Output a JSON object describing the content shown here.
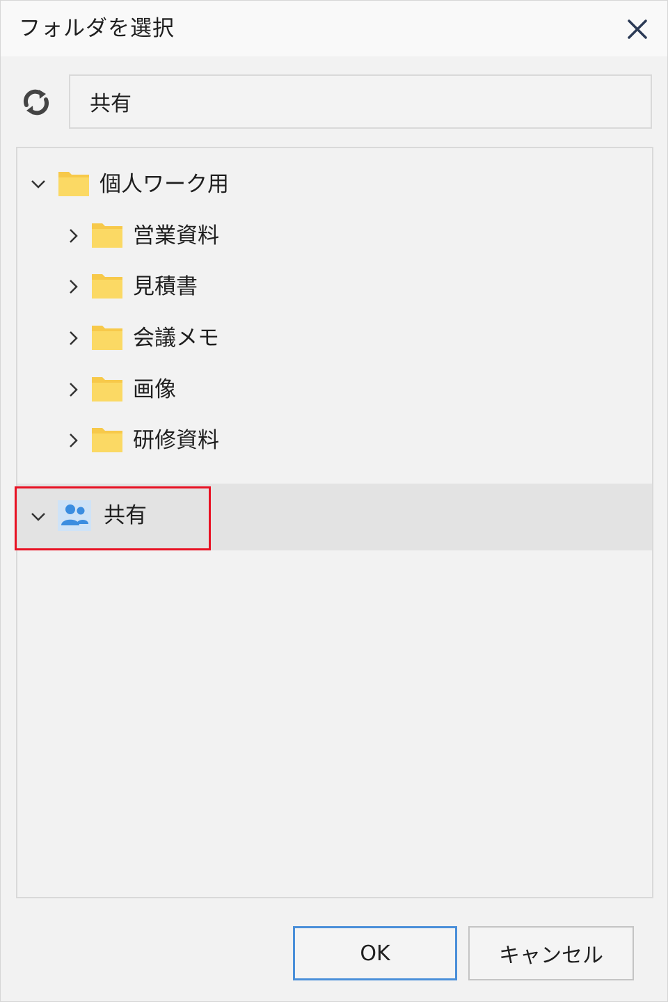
{
  "dialog": {
    "title": "フォルダを選択",
    "path_value": "共有"
  },
  "tree": {
    "root_personal": {
      "label": "個人ワーク用",
      "expanded": true
    },
    "children": [
      {
        "label": "営業資料"
      },
      {
        "label": "見積書"
      },
      {
        "label": "会議メモ"
      },
      {
        "label": "画像"
      },
      {
        "label": "研修資料"
      }
    ],
    "root_shared": {
      "label": "共有",
      "expanded": true,
      "selected": true
    }
  },
  "buttons": {
    "ok_label": "OK",
    "cancel_label": "キャンセル"
  },
  "icons": {
    "close": "close-icon",
    "refresh": "sync-icon",
    "folder": "folder-icon",
    "shared": "shared-users-icon",
    "expanded": "chevron-down-icon",
    "collapsed": "chevron-right-icon"
  },
  "colors": {
    "folder": "#f7c94a",
    "folder_light": "#fbd964",
    "shared_icon": "#3b8de0",
    "selection_outline": "#e81123",
    "ok_border": "#4a8fd9",
    "close_icon": "#2b3a55"
  }
}
